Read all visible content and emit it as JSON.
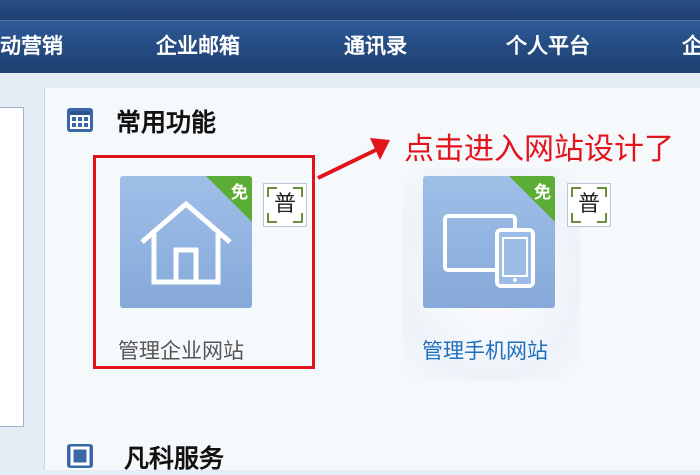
{
  "nav": {
    "items": [
      "动营销",
      "企业邮箱",
      "通讯录",
      "个人平台",
      "企"
    ]
  },
  "sections": {
    "common": {
      "title": "常用功能"
    },
    "services": {
      "title": "凡科服务"
    }
  },
  "tiles": [
    {
      "label": "管理企业网站",
      "corner": "免",
      "badge": "普"
    },
    {
      "label": "管理手机网站",
      "corner": "免",
      "badge": "普"
    }
  ],
  "annotation": {
    "text": "点击进入网站设计了"
  },
  "colors": {
    "nav_bg": "#244a80",
    "accent_red": "#e3131b",
    "corner_green": "#5cad35",
    "link_blue": "#1f6fbf"
  }
}
